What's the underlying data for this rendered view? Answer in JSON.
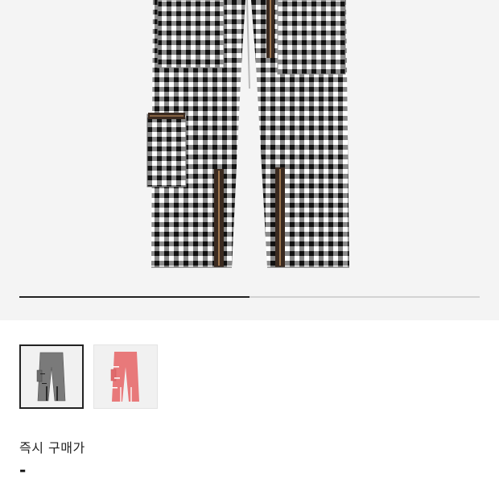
{
  "product": {
    "gallery": {
      "progress": 0.5,
      "progress_track_color": "#d2d2d2",
      "progress_fill_color": "#222222",
      "thumbnails": [
        {
          "name": "gingham-black-white",
          "selected": true
        },
        {
          "name": "gingham-red-white",
          "selected": false
        }
      ]
    },
    "price": {
      "label": "즉시 구매가",
      "value": "-"
    }
  }
}
